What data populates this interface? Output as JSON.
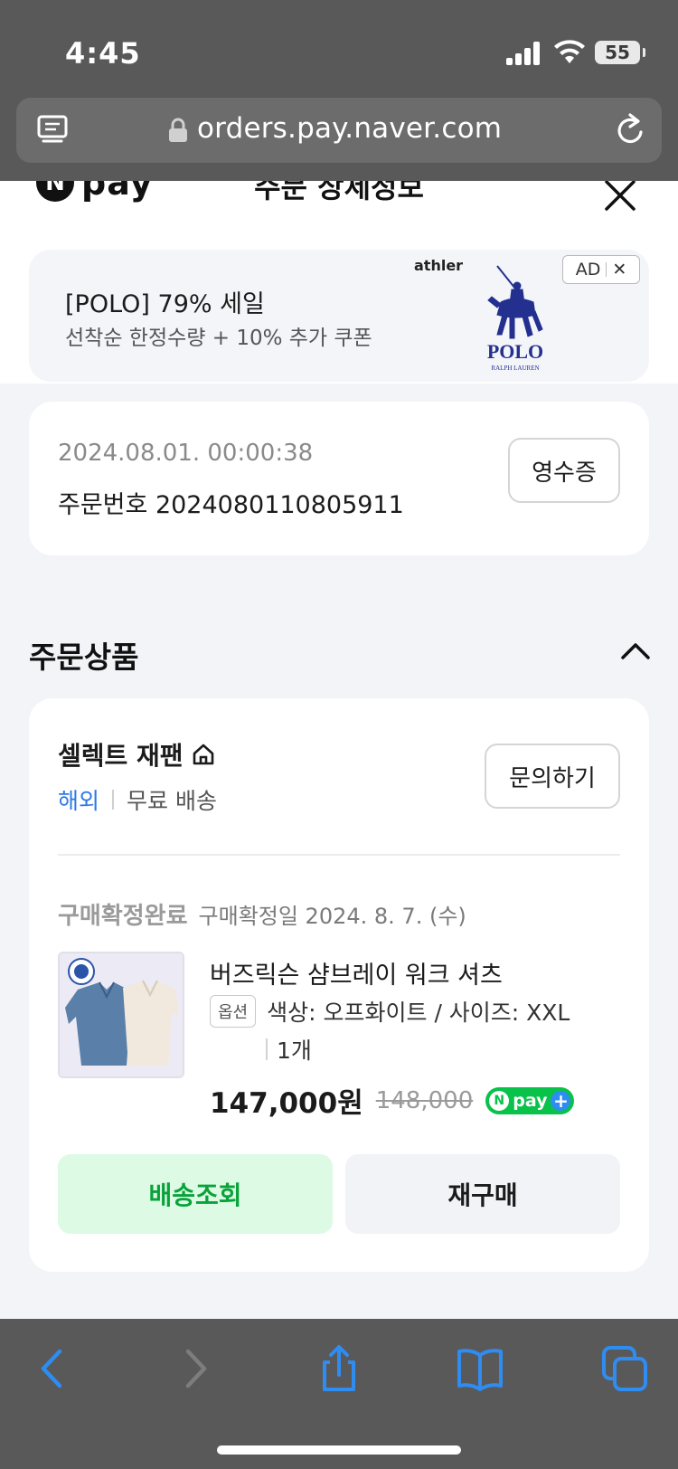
{
  "status_bar": {
    "time": "4:45",
    "battery": "55"
  },
  "browser": {
    "url": "orders.pay.naver.com"
  },
  "header": {
    "logo_badge": "N",
    "logo_word": "pay",
    "title": "주문 상세정보"
  },
  "ad": {
    "title": "[POLO] 79% 세일",
    "subtitle": "선착순 한정수량 + 10% 추가 쿠폰",
    "brand": "athler",
    "logo_text": "POLO",
    "logo_subtext": "RALPH LAUREN",
    "badge_label": "AD",
    "badge_close": "✕"
  },
  "order": {
    "date": "2024.08.01. 00:00:38",
    "number_label": "주문번호 2024080110805911",
    "receipt_button": "영수증"
  },
  "section": {
    "title": "주문상품"
  },
  "store": {
    "name": "셀렉트 재팬",
    "tag_abroad": "해외",
    "tag_shipping": "무료 배송",
    "inquiry_button": "문의하기"
  },
  "product": {
    "status": "구매확정완료",
    "status_date": "구매확정일 2024. 8. 7. (수)",
    "name": "버즈릭슨 샴브레이 워크 셔츠",
    "option_tag": "옵션",
    "option_value": "색상: 오프화이트 / 사이즈: XXL",
    "quantity": "1개",
    "price": "147,000원",
    "original_price": "148,000",
    "npay_badge_n": "N",
    "npay_badge_word": "pay",
    "npay_badge_plus": "+"
  },
  "actions": {
    "track_button": "배송조회",
    "rebuy_button": "재구매"
  },
  "colors": {
    "accent_blue": "#2f78e6",
    "npay_green": "#08c24a",
    "track_bg": "#ddfae4",
    "ios_blue": "#2f8cf1"
  }
}
